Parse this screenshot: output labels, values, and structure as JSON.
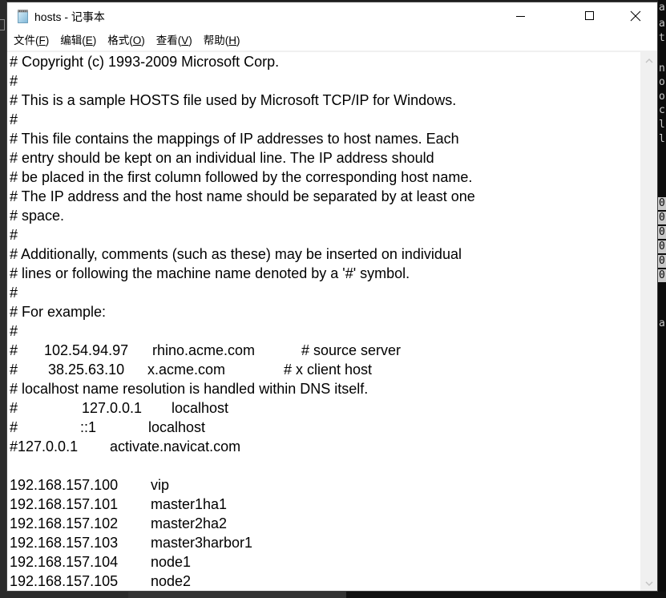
{
  "window": {
    "title": "hosts - 记事本",
    "controls": {
      "minimize": "minimize",
      "maximize": "maximize",
      "close": "close"
    }
  },
  "menu": [
    {
      "label": "文件(",
      "accel": "F",
      "end": ")"
    },
    {
      "label": "编辑(",
      "accel": "E",
      "end": ")"
    },
    {
      "label": "格式(",
      "accel": "O",
      "end": ")"
    },
    {
      "label": "查看(",
      "accel": "V",
      "end": ")"
    },
    {
      "label": "帮助(",
      "accel": "H",
      "end": ")"
    }
  ],
  "editor": {
    "lines": [
      {
        "text": "# Copyright (c) 1993-2009 Microsoft Corp."
      },
      {
        "text": "#"
      },
      {
        "text": "# This is a sample HOSTS file used by Microsoft TCP/IP for Windows."
      },
      {
        "text": "#"
      },
      {
        "text": "# This file contains the mappings of IP addresses to host names. Each"
      },
      {
        "text": "# entry should be kept on an individual line. The IP address should"
      },
      {
        "text": "# be placed in the first column followed by the corresponding host name."
      },
      {
        "text": "# The IP address and the host name should be separated by at least one"
      },
      {
        "text": "# space."
      },
      {
        "text": "#"
      },
      {
        "text": "# Additionally, comments (such as these) may be inserted on individual"
      },
      {
        "text": "# lines or following the machine name denoted by a '#' symbol."
      },
      {
        "text": "#"
      },
      {
        "text": "# For example:"
      },
      {
        "text": "#"
      },
      {
        "cols": [
          "#",
          "102.54.94.97",
          "rhino.acme.com",
          "# source server"
        ]
      },
      {
        "cols": [
          "#",
          "38.25.63.10",
          "x.acme.com",
          "# x client host"
        ]
      },
      {
        "text": "# localhost name resolution is handled within DNS itself."
      },
      {
        "cols": [
          "#",
          "127.0.0.1",
          "localhost",
          ""
        ]
      },
      {
        "cols": [
          "#",
          "::1",
          "localhost",
          ""
        ]
      },
      {
        "cols": [
          "#127.0.0.1",
          "",
          "activate.navicat.com",
          ""
        ]
      },
      {
        "text": ""
      },
      {
        "cols": [
          "192.168.157.100",
          "",
          "vip",
          ""
        ]
      },
      {
        "cols": [
          "192.168.157.101",
          "",
          "master1ha1",
          ""
        ]
      },
      {
        "cols": [
          "192.168.157.102",
          "",
          "master2ha2",
          ""
        ]
      },
      {
        "cols": [
          "192.168.157.103",
          "",
          "master3harbor1",
          ""
        ]
      },
      {
        "cols": [
          "192.168.157.104",
          "",
          "node1",
          ""
        ]
      },
      {
        "cols": [
          "192.168.157.105",
          "",
          "node2",
          ""
        ]
      }
    ]
  },
  "background_window": {
    "chars": [
      "a",
      "a",
      "t",
      "",
      "n",
      "o",
      "o",
      "c",
      "l",
      "l",
      "",
      "",
      "0",
      "0",
      "0",
      "0",
      "0",
      "0",
      "",
      "a"
    ]
  }
}
